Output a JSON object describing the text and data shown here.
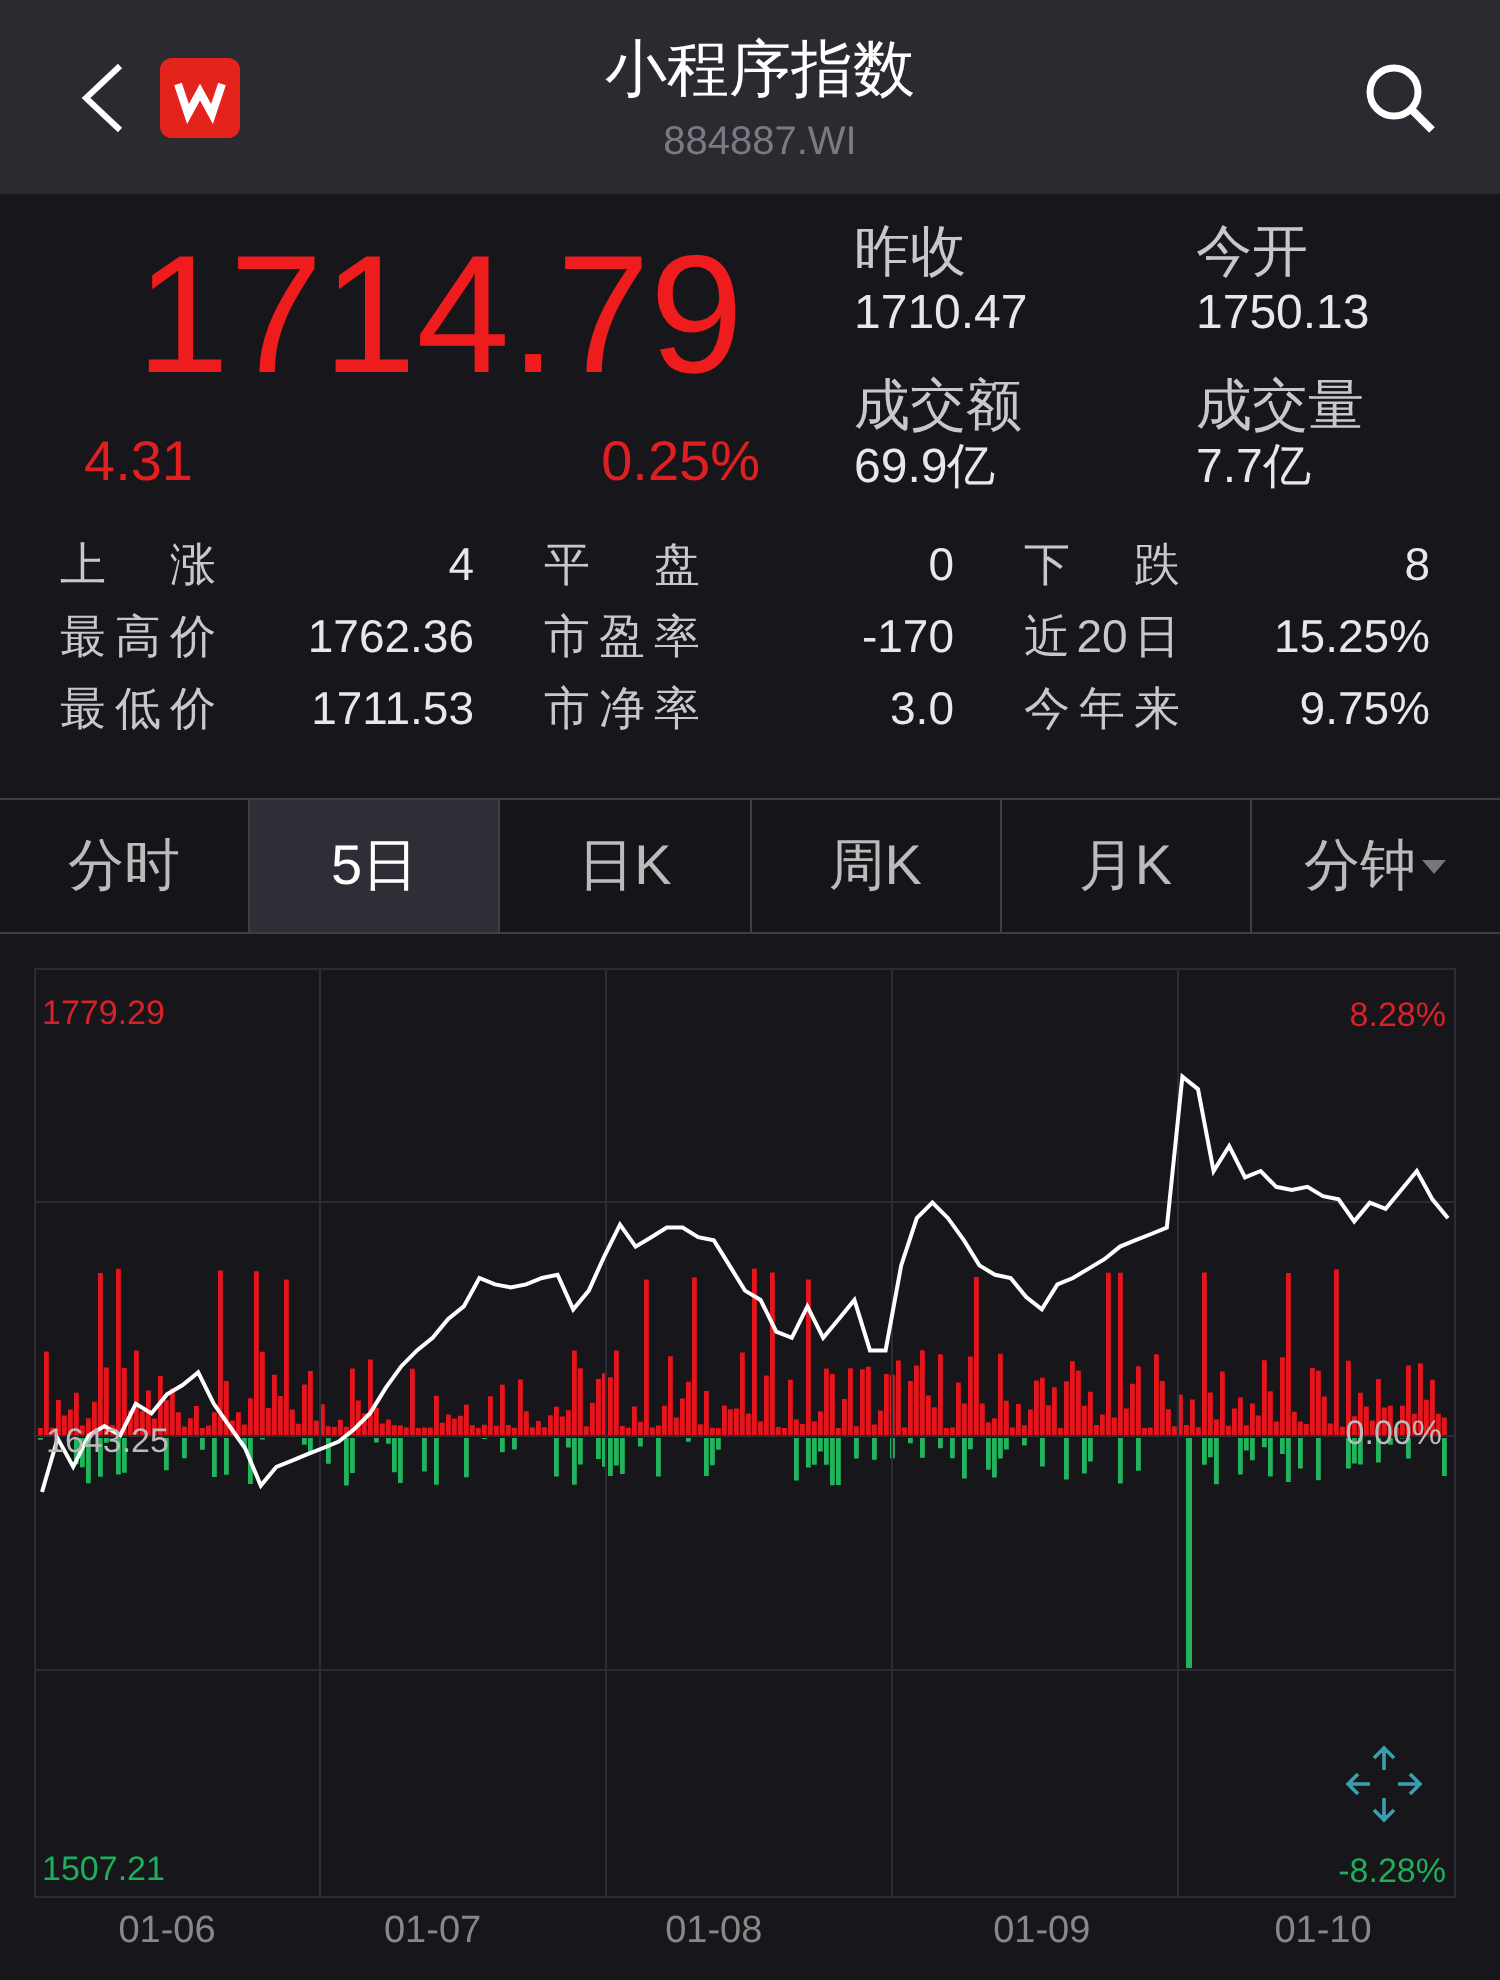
{
  "header": {
    "title": "小程序指数",
    "code": "884887.WI"
  },
  "quote": {
    "price": "1714.79",
    "change": "4.31",
    "change_pct": "0.25%"
  },
  "summary": [
    {
      "label": "昨收",
      "value": "1710.47"
    },
    {
      "label": "今开",
      "value": "1750.13"
    },
    {
      "label": "成交额",
      "value": "69.9亿"
    },
    {
      "label": "成交量",
      "value": "7.7亿"
    }
  ],
  "stats": [
    [
      {
        "label": "上涨",
        "value": "4"
      },
      {
        "label": "平盘",
        "value": "0"
      },
      {
        "label": "下跌",
        "value": "8"
      }
    ],
    [
      {
        "label": "最高价",
        "value": "1762.36"
      },
      {
        "label": "市盈率",
        "value": "-170"
      },
      {
        "label": "近20日",
        "value": "15.25%"
      }
    ],
    [
      {
        "label": "最低价",
        "value": "1711.53"
      },
      {
        "label": "市净率",
        "value": "3.0"
      },
      {
        "label": "今年来",
        "value": "9.75%"
      }
    ]
  ],
  "tabs": [
    {
      "label": "分时",
      "selected": false,
      "kind": "plain"
    },
    {
      "label": "5日",
      "selected": true,
      "kind": "plain"
    },
    {
      "label": "日K",
      "selected": false,
      "kind": "plain"
    },
    {
      "label": "周K",
      "selected": false,
      "kind": "plain"
    },
    {
      "label": "月K",
      "selected": false,
      "kind": "plain"
    },
    {
      "label": "分钟",
      "selected": false,
      "kind": "menu"
    }
  ],
  "chart": {
    "pct_high": "8.28%",
    "pct_base": "0.00%",
    "pct_low": "-8.28%",
    "chart_data": {
      "type": "line",
      "ylim": [
        1499.58,
        1793.91
      ],
      "yticks": [
        {
          "value": 1779.29,
          "label": "1779.29"
        },
        {
          "value": 1643.25,
          "label": "1643.25"
        },
        {
          "value": 1507.21,
          "label": "1507.21"
        }
      ],
      "categories": [
        null,
        null,
        null,
        null,
        null,
        null,
        null,
        null,
        "01-06",
        null,
        null,
        null,
        null,
        null,
        null,
        null,
        null,
        null,
        null,
        null,
        null,
        null,
        null,
        null,
        null,
        "01-07",
        null,
        null,
        null,
        null,
        null,
        null,
        null,
        null,
        null,
        null,
        null,
        null,
        null,
        null,
        null,
        null,
        null,
        "01-08",
        null,
        null,
        null,
        null,
        null,
        null,
        null,
        null,
        null,
        null,
        null,
        null,
        null,
        null,
        null,
        null,
        null,
        null,
        null,
        null,
        "01-09",
        null,
        null,
        null,
        null,
        null,
        null,
        null,
        null,
        null,
        null,
        null,
        null,
        null,
        null,
        null,
        null,
        null,
        "01-10",
        null,
        null,
        null,
        null,
        null,
        null,
        null,
        null
      ],
      "series": [
        {
          "color": "#ffffff",
          "values": [
            1628,
            1645,
            1636,
            1646,
            1649,
            1646,
            1656,
            1653,
            1659,
            1662,
            1666,
            1656,
            1649,
            1642,
            1630,
            1636,
            1638,
            1640,
            1642,
            1644,
            1648,
            1653,
            1661,
            1668,
            1673,
            1677,
            1683,
            1687,
            1696,
            1694,
            1693,
            1694,
            1696,
            1697,
            1686,
            1692,
            1703,
            1713,
            1706,
            1709,
            1712,
            1712,
            1709,
            1708,
            1700,
            1692,
            1689,
            1679,
            1677,
            1687,
            1677,
            1683,
            1689,
            1673,
            1673,
            1700,
            1715,
            1720,
            1715,
            1708,
            1700,
            1697,
            1696,
            1690,
            1686,
            1694,
            1696,
            1699,
            1702,
            1706,
            1708,
            1710,
            1712,
            1760,
            1756,
            1730,
            1738,
            1728,
            1730,
            1725,
            1724,
            1725,
            1722,
            1721,
            1714,
            1720,
            1718,
            1724,
            1730,
            1721,
            1715
          ]
        }
      ]
    }
  }
}
